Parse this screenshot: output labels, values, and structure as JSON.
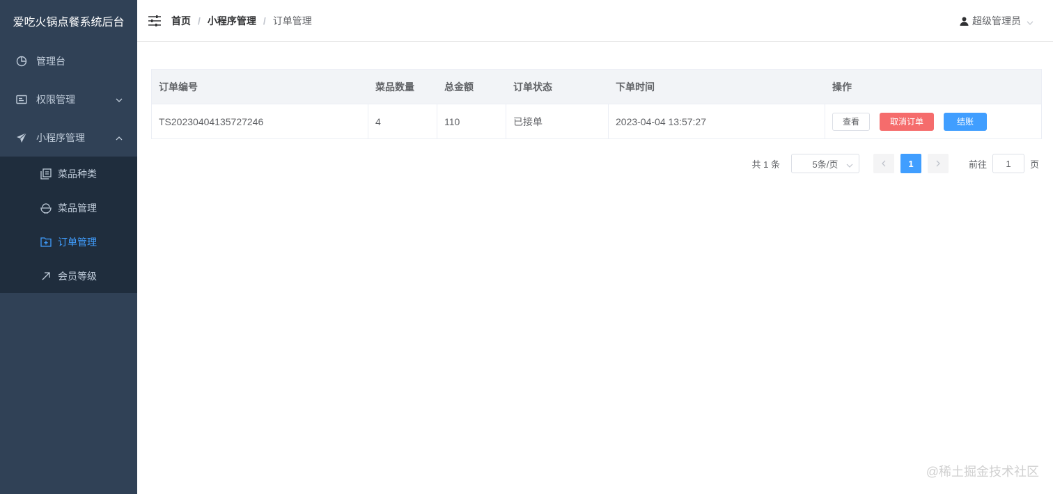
{
  "sidebar": {
    "brand": "爱吃火锅点餐系统后台",
    "items": [
      {
        "label": "管理台",
        "icon": "pie-chart-icon"
      },
      {
        "label": "权限管理",
        "icon": "id-card-icon"
      },
      {
        "label": "小程序管理",
        "icon": "paper-plane-icon"
      }
    ],
    "subitems": [
      {
        "label": "菜品种类",
        "icon": "copy-icon"
      },
      {
        "label": "菜品管理",
        "icon": "bowl-icon"
      },
      {
        "label": "订单管理",
        "icon": "folder-add-icon"
      },
      {
        "label": "会员等级",
        "icon": "arrow-up-right-icon"
      }
    ],
    "colors": {
      "bg": "#304156",
      "submenu_bg": "#1f2d3d",
      "active": "#409eff"
    }
  },
  "header": {
    "breadcrumb": [
      "首页",
      "小程序管理",
      "订单管理"
    ],
    "separator": "/",
    "user": "超级管理员"
  },
  "table": {
    "columns": [
      "订单编号",
      "菜品数量",
      "总金额",
      "订单状态",
      "下单时间",
      "操作"
    ],
    "rows": [
      {
        "order_no": "TS20230404135727246",
        "qty": "4",
        "total": "110",
        "status": "已接单",
        "time": "2023-04-04 13:57:27"
      }
    ],
    "actions": {
      "view": "查看",
      "cancel": "取消订单",
      "checkout": "结账"
    }
  },
  "pagination": {
    "total_label": "共 1 条",
    "page_size": "5条/页",
    "current_page": "1",
    "goto_label": "前往",
    "goto_value": "1",
    "page_suffix": "页"
  },
  "watermark": "@稀土掘金技术社区"
}
